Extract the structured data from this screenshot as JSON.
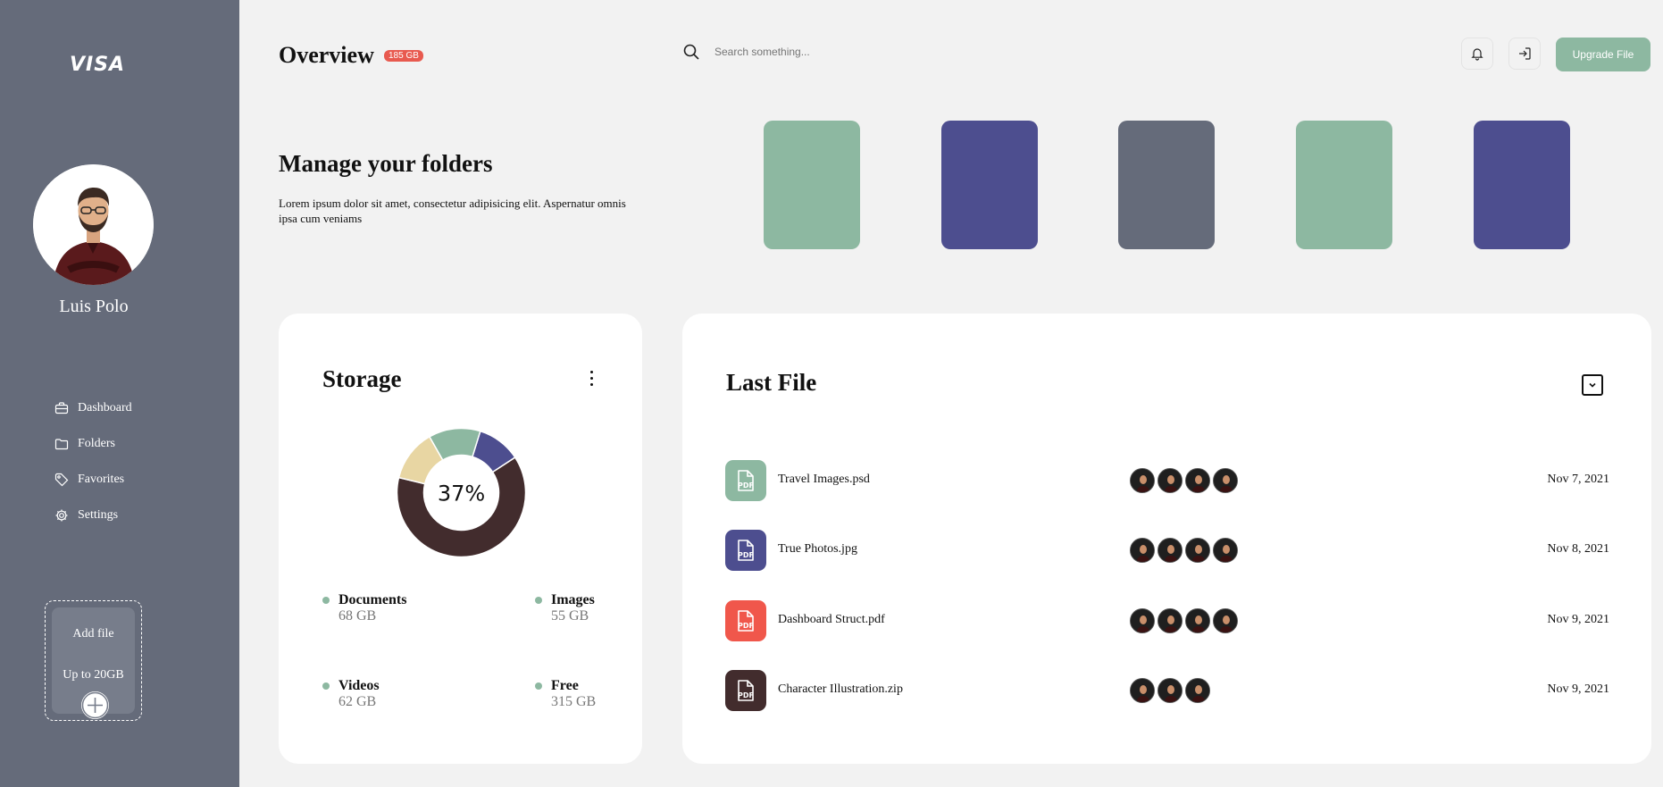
{
  "sidebar": {
    "logo": "VISA",
    "user_name": "Luis Polo",
    "nav": [
      {
        "label": "Dashboard",
        "icon": "briefcase-icon"
      },
      {
        "label": "Folders",
        "icon": "folder-icon"
      },
      {
        "label": "Favorites",
        "icon": "tag-icon"
      },
      {
        "label": "Settings",
        "icon": "gear-icon"
      }
    ],
    "add_file": {
      "title": "Add file",
      "subtitle": "Up to 20GB"
    }
  },
  "header": {
    "title": "Overview",
    "badge": "185 GB",
    "search_placeholder": "Search something...",
    "upgrade_label": "Upgrade File"
  },
  "hero": {
    "title": "Manage your folders",
    "text": "Lorem ipsum dolor sit amet, consectetur adipisicing elit. Aspernatur omnis ipsa cum veniams"
  },
  "folders": [
    {
      "color": "#8db8a1"
    },
    {
      "color": "#4d4e8f"
    },
    {
      "color": "#656b7a"
    },
    {
      "color": "#8db8a1"
    },
    {
      "color": "#4d4e8f"
    }
  ],
  "storage": {
    "title": "Storage",
    "percent": "37%",
    "legend": [
      {
        "name": "Documents",
        "value": "68 GB"
      },
      {
        "name": "Images",
        "value": "55 GB"
      },
      {
        "name": "Videos",
        "value": "62 GB"
      },
      {
        "name": "Free",
        "value": "315 GB"
      }
    ],
    "chart_data": {
      "type": "pie",
      "colors": [
        "#4d4e8f",
        "#422c2d",
        "#e8d6a3",
        "#8db8a1"
      ],
      "values": [
        0.11,
        0.63,
        0.13,
        0.13
      ]
    }
  },
  "last_file": {
    "title": "Last File",
    "files": [
      {
        "name": "Travel Images.psd",
        "date": "Nov 7, 2021",
        "color": "#8db8a1",
        "icon_text": "PDF",
        "avatars": 4
      },
      {
        "name": "True Photos.jpg",
        "date": "Nov 8, 2021",
        "color": "#4d4e8f",
        "icon_text": "PDF",
        "avatars": 4
      },
      {
        "name": "Dashboard Struct.pdf",
        "date": "Nov 9, 2021",
        "color": "#f0574b",
        "icon_text": "PDF",
        "avatars": 4
      },
      {
        "name": "Character Illustration.zip",
        "date": "Nov 9, 2021",
        "color": "#422c2d",
        "icon_text": "PDF",
        "avatars": 3
      }
    ]
  }
}
